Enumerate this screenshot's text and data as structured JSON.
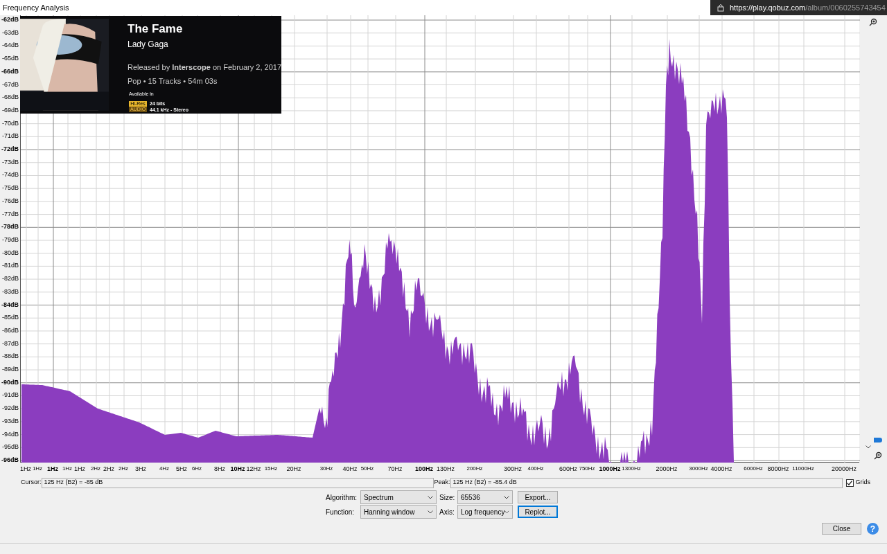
{
  "window": {
    "title": "Frequency Analysis"
  },
  "browser_overlay": {
    "url_host": "https://play.qobuz.com",
    "url_path": "/album/",
    "url_id": "0060255743454"
  },
  "album_card": {
    "title": "The Fame",
    "artist": "Lady Gaga",
    "released": "Released by **Interscope** on February 2, 2017",
    "details": "Pop • 15 Tracks • 54m 03s",
    "available_label": "Available in",
    "badge_top": "Hi-Res",
    "badge_bottom": "AUDIO",
    "quality_bits": "24 bits",
    "quality_rate": "44.1 kHz - Stereo"
  },
  "y_labels": [
    {
      "text": "-62dB",
      "major": true
    },
    {
      "text": "-63dB",
      "major": false
    },
    {
      "text": "-64dB",
      "major": false
    },
    {
      "text": "-65dB",
      "major": false
    },
    {
      "text": "-66dB",
      "major": true
    },
    {
      "text": "-67dB",
      "major": false
    },
    {
      "text": "-68dB",
      "major": false
    },
    {
      "text": "-69dB",
      "major": false
    },
    {
      "text": "-70dB",
      "major": false
    },
    {
      "text": "-71dB",
      "major": false
    },
    {
      "text": "-72dB",
      "major": true
    },
    {
      "text": "-73dB",
      "major": false
    },
    {
      "text": "-74dB",
      "major": false
    },
    {
      "text": "-75dB",
      "major": false
    },
    {
      "text": "-76dB",
      "major": false
    },
    {
      "text": "-77dB",
      "major": false
    },
    {
      "text": "-78dB",
      "major": true
    },
    {
      "text": "-79dB",
      "major": false
    },
    {
      "text": "-80dB",
      "major": false
    },
    {
      "text": "-81dB",
      "major": false
    },
    {
      "text": "-82dB",
      "major": false
    },
    {
      "text": "-83dB",
      "major": false
    },
    {
      "text": "-84dB",
      "major": true
    },
    {
      "text": "-85dB",
      "major": false
    },
    {
      "text": "-86dB",
      "major": false
    },
    {
      "text": "-87dB",
      "major": false
    },
    {
      "text": "-88dB",
      "major": false
    },
    {
      "text": "-89dB",
      "major": false
    },
    {
      "text": "-90dB",
      "major": true
    },
    {
      "text": "-91dB",
      "major": false
    },
    {
      "text": "-92dB",
      "major": false
    },
    {
      "text": "-93dB",
      "major": false
    },
    {
      "text": "-94dB",
      "major": false
    },
    {
      "text": "-95dB",
      "major": false
    },
    {
      "text": "-96dB",
      "major": true
    }
  ],
  "x_labels": [
    {
      "text": "1Hz",
      "major": false
    },
    {
      "text": "1Hz",
      "major": false
    },
    {
      "text": "1Hz",
      "major": true
    },
    {
      "text": "1Hz",
      "major": false
    },
    {
      "text": "1Hz",
      "major": false
    },
    {
      "text": "2Hz",
      "major": false
    },
    {
      "text": "2Hz",
      "major": false
    },
    {
      "text": "2Hz",
      "major": false
    },
    {
      "text": "3Hz",
      "major": false
    },
    {
      "text": "4Hz",
      "major": false
    },
    {
      "text": "5Hz",
      "major": false
    },
    {
      "text": "6Hz",
      "major": false
    },
    {
      "text": "8Hz",
      "major": false
    },
    {
      "text": "10Hz",
      "major": true
    },
    {
      "text": "12Hz",
      "major": false
    },
    {
      "text": "15Hz",
      "major": false
    },
    {
      "text": "20Hz",
      "major": false
    },
    {
      "text": "30Hz",
      "major": false
    },
    {
      "text": "40Hz",
      "major": false
    },
    {
      "text": "50Hz",
      "major": false
    },
    {
      "text": "70Hz",
      "major": false
    },
    {
      "text": "100Hz",
      "major": true
    },
    {
      "text": "130Hz",
      "major": false
    },
    {
      "text": "200Hz",
      "major": false
    },
    {
      "text": "300Hz",
      "major": false
    },
    {
      "text": "400Hz",
      "major": false
    },
    {
      "text": "600Hz",
      "major": false
    },
    {
      "text": "750Hz",
      "major": false
    },
    {
      "text": "1000Hz",
      "major": true
    },
    {
      "text": "1300Hz",
      "major": false
    },
    {
      "text": "2000Hz",
      "major": false
    },
    {
      "text": "3000Hz",
      "major": false
    },
    {
      "text": "4000Hz",
      "major": false
    },
    {
      "text": "6000Hz",
      "major": false
    },
    {
      "text": "8000Hz",
      "major": false
    },
    {
      "text": "11000Hz",
      "major": false
    },
    {
      "text": "20000Hz",
      "major": false
    }
  ],
  "cursor": {
    "label": "Cursor:",
    "value": "125 Hz (B2) = -85 dB"
  },
  "peak": {
    "label": "Peak:",
    "value": "125 Hz (B2) = -85.4 dB"
  },
  "grids": {
    "label": "Grids",
    "checked": true
  },
  "algorithm": {
    "label": "Algorithm:",
    "value": "Spectrum"
  },
  "size": {
    "label": "Size:",
    "value": "65536"
  },
  "function": {
    "label": "Function:",
    "value": "Hanning window"
  },
  "axis": {
    "label": "Axis:",
    "value": "Log frequency"
  },
  "buttons": [
    {
      "label": "Export...",
      "focused": false
    },
    {
      "label": "Replot...",
      "focused": true
    }
  ],
  "close_button": {
    "label": "Close"
  },
  "help_button": {
    "label": "?"
  }
}
